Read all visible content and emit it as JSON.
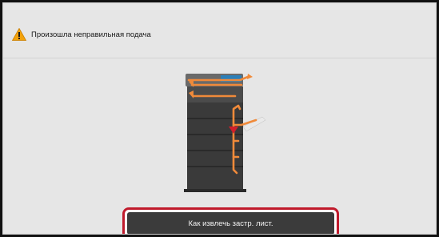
{
  "alert": {
    "icon": "warning-icon",
    "message": "Произошла неправильная подача"
  },
  "illustration": {
    "icon": "copier-paper-path-illustration"
  },
  "action_button": {
    "label": "Как извлечь застр. лист."
  },
  "colors": {
    "background": "#e6e6e6",
    "button_dark": "#3b3b3b",
    "highlight_border": "#c01a2c",
    "paper_path": "#f08a3a",
    "jam_marker": "#d21f2a"
  }
}
